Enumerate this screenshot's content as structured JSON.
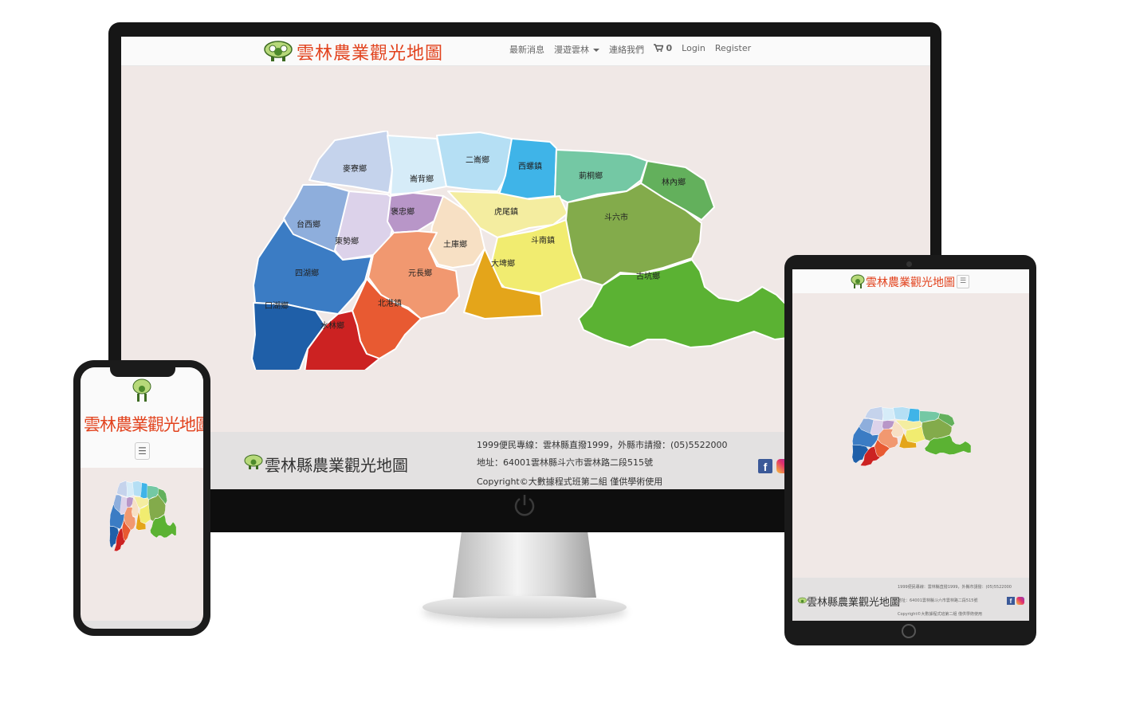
{
  "site": {
    "title": "雲林農業觀光地圖",
    "footer_title": "雲林縣農業觀光地圖"
  },
  "nav": {
    "items": [
      {
        "label": "最新消息"
      },
      {
        "label": "漫遊雲林"
      },
      {
        "label": "連絡我們"
      },
      {
        "label": "0"
      },
      {
        "label": "Login"
      },
      {
        "label": "Register"
      }
    ],
    "cart_icon": "cart-icon",
    "toggler_glyph": "☰"
  },
  "map": {
    "regions": [
      {
        "name": "麥寮鄉",
        "color": "#c5d3ec"
      },
      {
        "name": "崙背鄉",
        "color": "#d6ecf8"
      },
      {
        "name": "二崙鄉",
        "color": "#b5dff4"
      },
      {
        "name": "西螺鎮",
        "color": "#3fb4e8"
      },
      {
        "name": "莿桐鄉",
        "color": "#74c8a4"
      },
      {
        "name": "林內鄉",
        "color": "#63b05c"
      },
      {
        "name": "台西鄉",
        "color": "#8eaedc"
      },
      {
        "name": "東勢鄉",
        "color": "#dcd2ea"
      },
      {
        "name": "褒忠鄉",
        "color": "#b896c8"
      },
      {
        "name": "虎尾鎮",
        "color": "#f4eda0"
      },
      {
        "name": "土庫鄉",
        "color": "#f7e0c4"
      },
      {
        "name": "斗南鎮",
        "color": "#f1ec70"
      },
      {
        "name": "斗六市",
        "color": "#83ab4b"
      },
      {
        "name": "大埤鄉",
        "color": "#e4a51a"
      },
      {
        "name": "古坑鄉",
        "color": "#5bb233"
      },
      {
        "name": "四湖鄉",
        "color": "#3b7cc4"
      },
      {
        "name": "元長鄉",
        "color": "#f19870"
      },
      {
        "name": "口湖鄉",
        "color": "#1f5fa8"
      },
      {
        "name": "北港鎮",
        "color": "#e85a32"
      },
      {
        "name": "水林鄉",
        "color": "#cc2222"
      }
    ]
  },
  "footer": {
    "hotline": "1999便民專線：雲林縣直撥1999，外縣市請撥：(05)5522000",
    "address": "地址：64001雲林縣斗六市雲林路二段515號",
    "copyright": "Copyright©大數據程式班第二組 僅供學術使用",
    "social": [
      {
        "icon": "facebook-icon",
        "glyph": "f"
      },
      {
        "icon": "instagram-icon"
      }
    ]
  },
  "colors": {
    "title_accent": "#e2431e",
    "page_bg": "#f0e8e6",
    "footer_bg": "#e3e1e1"
  }
}
